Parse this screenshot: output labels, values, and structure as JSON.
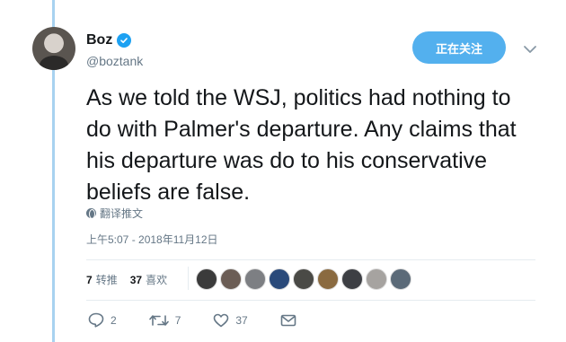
{
  "author": {
    "name": "Boz",
    "handle": "@boztank",
    "verified": true
  },
  "follow_button": {
    "label": "正在关注"
  },
  "tweet": {
    "text": "As we told the WSJ, politics had nothing to do with Palmer's departure. Any claims that his departure was do to his conservative beliefs are false.",
    "translate_label": "翻译推文",
    "timestamp": "上午5:07 - 2018年11月12日"
  },
  "stats": {
    "retweets": {
      "count": "7",
      "label": "转推"
    },
    "likes": {
      "count": "37",
      "label": "喜欢"
    }
  },
  "likers": [
    "#3b3b3b",
    "#6b5d55",
    "#7d7f83",
    "#2a4a7a",
    "#4a4a46",
    "#8a6a40",
    "#3d3f44",
    "#a6a3a0",
    "#5b6a78"
  ],
  "actions": {
    "reply_count": "2",
    "retweet_count": "7",
    "like_count": "37"
  },
  "colors": {
    "accent": "#1da1f2",
    "follow_bg": "#53b0ee",
    "thread_line": "#a8d2f0",
    "muted_text": "#657786"
  }
}
